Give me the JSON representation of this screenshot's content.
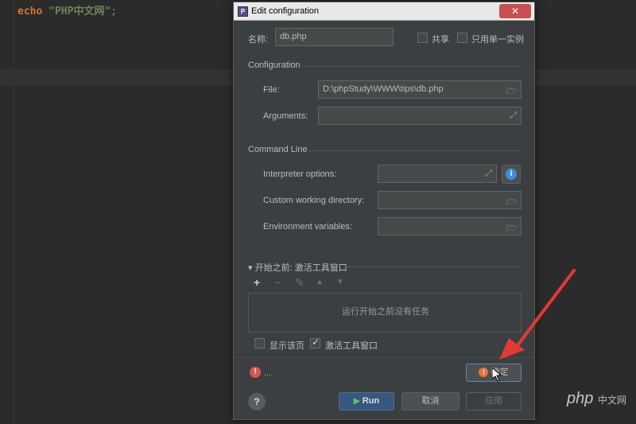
{
  "editor": {
    "code_keyword": "echo",
    "code_string": "\"PHP中文网\"",
    "code_semicolon": ";"
  },
  "dialog": {
    "title": "Edit configuration",
    "close_symbol": "✕",
    "name_label": "名称:",
    "name_value": "db.php",
    "share_label": "共享",
    "single_instance_label": "只用单一实例",
    "configuration_section": "Configuration",
    "file_label": "File:",
    "file_value": "D:\\phpStudy\\WWW\\tips\\db.php",
    "arguments_label": "Arguments:",
    "command_line_section": "Command Line",
    "interpreter_label": "Interpreter options:",
    "working_dir_label": "Custom working directory:",
    "env_vars_label": "Environment variables:",
    "before_launch_section": "▾ 开始之前: 激活工具窗口",
    "tasks_empty_text": "运行开始之前没有任务",
    "show_page_label": "显示该页",
    "activate_tool_window_label": "激活工具窗口",
    "error_text": "...",
    "ok_label": "确定",
    "run_label": "Run",
    "cancel_label": "取消",
    "apply_label": "应用",
    "help_symbol": "?"
  },
  "checkboxes": {
    "share": false,
    "single_instance": false,
    "show_page": false,
    "activate_tool_window": true
  },
  "icons": {
    "folder": "🗁",
    "expand": "⤢",
    "add": "+",
    "remove": "−",
    "edit": "✎",
    "up": "▲",
    "down": "▼",
    "error": "!",
    "info": "i"
  },
  "watermark": {
    "text": "php",
    "suffix": "中文网"
  },
  "colors": {
    "accent_arrow": "#e53935",
    "run_button": "#365880",
    "ok_border": "#5a86b3"
  }
}
